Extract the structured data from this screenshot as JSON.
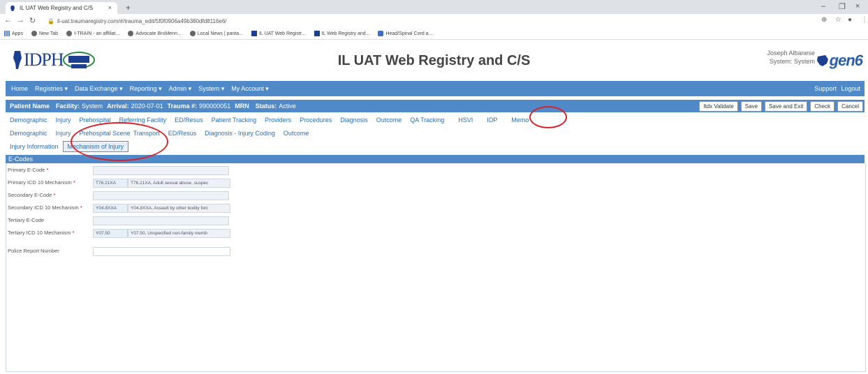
{
  "browser": {
    "tab_title": "IL UAT Web Registry and C/S",
    "url": "il-uat.traumaregistry.com/#/trauma_edit/5f0f0906a49b380dfd8116e6/",
    "bookmarks": [
      "Apps",
      "New Tab",
      "I-TRAIN - an affiliat...",
      "Advocate BroMenn...",
      "Local News | panta...",
      "IL UAT Web Registr...",
      "IL Web Registry and...",
      "Head/Spinal Cord a..."
    ]
  },
  "header": {
    "logo_text": "IDPH",
    "app_title": "IL UAT Web Registry and C/S",
    "user_name": "Joseph Albanese",
    "user_role": "System: System",
    "brand": "gen6"
  },
  "main_nav": {
    "items": [
      "Home",
      "Registries ▾",
      "Data Exchange ▾",
      "Reporting ▾",
      "Admin ▾",
      "System ▾",
      "My Account ▾"
    ],
    "support": "Support",
    "logout": "Logout"
  },
  "patient_bar": {
    "name_label": "Patient Name",
    "facility_label": "Facility:",
    "facility_value": "System",
    "arrival_label": "Arrival:",
    "arrival_value": "2020-07-01",
    "trauma_label": "Trauma #:",
    "trauma_value": "990000051",
    "mrn_label": "MRN",
    "status_label": "Status:",
    "status_value": "Active",
    "buttons": [
      "Itdx Validate",
      "Save",
      "Save and Exit",
      "Check",
      "Cancel"
    ]
  },
  "tabs_level1": [
    "Demographic",
    "Injury",
    "Prehospital",
    "Referring Facility",
    "ED/Resus",
    "Patient Tracking",
    "Providers",
    "Procedures",
    "Diagnosis",
    "Outcome",
    "QA Tracking",
    "HSVI",
    "IDP",
    "Memo"
  ],
  "tabs_level2": [
    "Demographic",
    "Injury",
    "Prehospital Scene",
    "Transport",
    "ED/Resus",
    "Diagnosis - Injury Coding",
    "Outcome"
  ],
  "tabs_level3": [
    "Injury Information",
    "Mechanism of Injury"
  ],
  "section_title": "E-Codes",
  "fields": [
    {
      "label": "Primary E-Code",
      "required": "*",
      "code": "",
      "desc": ""
    },
    {
      "label": "Primary ICD 10 Mechanism",
      "required": "*",
      "code": "T76.21XA",
      "desc": "T76.21XA, Adult sexual abuse, suspec"
    },
    {
      "label": "Secondary E-Code",
      "required": "*",
      "code": "",
      "desc": ""
    },
    {
      "label": "Secondary ICD 10 Mechanism",
      "required": "*",
      "code": "Y04.8XXA",
      "desc": "Y04.8XXA, Assault by other bodily forc"
    },
    {
      "label": "Tertiary E-Code",
      "required": "",
      "code": "",
      "desc": ""
    },
    {
      "label": "Tertiary ICD 10 Mechanism",
      "required": "*",
      "code": "Y07.50",
      "desc": "Y07.50, Unspecified non-family memb"
    },
    {
      "label": "Police Report Number",
      "required": "",
      "code": "",
      "desc": ""
    }
  ],
  "colors": {
    "accent": "#4f89c8",
    "annotation": "#d6232a",
    "link": "#2a6db5"
  }
}
